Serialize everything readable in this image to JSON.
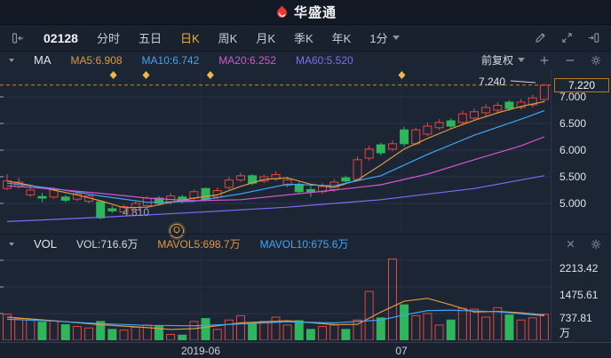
{
  "header": {
    "logo_text": "华盛通"
  },
  "toolbar": {
    "stock_code": "02128",
    "tabs": [
      "分时",
      "五日",
      "日K",
      "周K",
      "月K",
      "季K",
      "年K"
    ],
    "active_tab": "日K",
    "period_dropdown": "1分"
  },
  "chart": {
    "ma_label": "MA",
    "ma_items": [
      {
        "text": "MA5:6.908",
        "color": "#e09a3e"
      },
      {
        "text": "MA10:6.742",
        "color": "#42a4f5"
      },
      {
        "text": "MA20:6.252",
        "color": "#d357cf"
      },
      {
        "text": "MA60:5.520",
        "color": "#7f6cf2"
      }
    ],
    "adjust_label": "前复权",
    "high_label": "7.240",
    "low_label": "4.810",
    "event_marker": "Q",
    "price_axis": {
      "current": "7.220",
      "ticks": [
        "7.000",
        "6.500",
        "6.000",
        "5.500",
        "5.000"
      ]
    }
  },
  "vol": {
    "label": "VOL",
    "value": {
      "text": "VOL:716.6万",
      "color": "#d5dae2"
    },
    "mavol5": {
      "text": "MAVOL5:698.7万",
      "color": "#e09a3e"
    },
    "mavol10": {
      "text": "MAVOL10:675.6万",
      "color": "#42a4f5"
    },
    "axis": [
      "2213.42",
      "1475.61",
      "737.81"
    ],
    "axis_unit": "万"
  },
  "xaxis": {
    "labels": [
      "2019-06",
      "07"
    ]
  },
  "colors": {
    "up": "#e8453c",
    "down": "#2eb65c",
    "ma5": "#e09a3e",
    "ma10": "#42a4f5",
    "ma20": "#d357cf",
    "ma60": "#7f6cf2",
    "accent": "#f0a83c",
    "dashed_line": "#bf8a3e",
    "diamond": "#edb94d",
    "grid": "#28334b",
    "grid_vertical": "#232e44",
    "pointer": "#cfd6df"
  },
  "chart_data": {
    "type": "candlestick+volume",
    "x_axis_labels": [
      "2019-06",
      "07"
    ],
    "price": {
      "ylim": [
        4.45,
        7.35
      ],
      "gridlines": [
        7.0,
        6.5,
        6.0,
        5.5,
        5.0
      ],
      "current_price": 7.22,
      "high_marker": 7.24,
      "low_marker": 4.81,
      "ma_values": {
        "MA5": 6.908,
        "MA10": 6.742,
        "MA20": 6.252,
        "MA60": 5.52
      },
      "candles": [
        [
          5.28,
          5.55,
          5.25,
          5.42
        ],
        [
          5.32,
          5.48,
          5.28,
          5.4
        ],
        [
          5.16,
          5.33,
          5.12,
          5.25
        ],
        [
          5.13,
          5.2,
          5.02,
          5.1
        ],
        [
          5.12,
          5.3,
          5.08,
          5.26
        ],
        [
          5.12,
          5.16,
          5.02,
          5.06
        ],
        [
          5.08,
          5.22,
          5.04,
          5.18
        ],
        [
          5.04,
          5.18,
          5.0,
          5.14
        ],
        [
          5.03,
          5.06,
          4.7,
          4.73
        ],
        [
          4.9,
          4.96,
          4.82,
          4.86
        ],
        [
          4.84,
          4.98,
          4.81,
          4.94
        ],
        [
          4.88,
          5.04,
          4.85,
          5.0
        ],
        [
          4.96,
          5.14,
          4.92,
          5.1
        ],
        [
          5.1,
          5.14,
          4.96,
          5.0
        ],
        [
          5.02,
          5.2,
          4.98,
          5.14
        ],
        [
          5.12,
          5.16,
          5.0,
          5.05
        ],
        [
          5.1,
          5.26,
          5.06,
          5.22
        ],
        [
          5.28,
          5.3,
          5.04,
          5.08
        ],
        [
          5.12,
          5.3,
          5.08,
          5.24
        ],
        [
          5.3,
          5.5,
          5.26,
          5.44
        ],
        [
          5.44,
          5.58,
          5.4,
          5.52
        ],
        [
          5.52,
          5.55,
          5.34,
          5.38
        ],
        [
          5.42,
          5.54,
          5.38,
          5.5
        ],
        [
          5.46,
          5.6,
          5.42,
          5.54
        ],
        [
          5.34,
          5.5,
          5.3,
          5.44
        ],
        [
          5.36,
          5.4,
          5.18,
          5.22
        ],
        [
          5.26,
          5.34,
          5.12,
          5.22
        ],
        [
          5.22,
          5.38,
          5.18,
          5.32
        ],
        [
          5.26,
          5.46,
          5.22,
          5.4
        ],
        [
          5.48,
          5.52,
          5.38,
          5.42
        ],
        [
          5.45,
          5.88,
          5.42,
          5.82
        ],
        [
          5.85,
          6.08,
          5.8,
          6.02
        ],
        [
          6.1,
          6.14,
          5.9,
          5.95
        ],
        [
          6.02,
          6.18,
          5.98,
          6.12
        ],
        [
          6.38,
          6.44,
          6.06,
          6.12
        ],
        [
          6.12,
          6.42,
          6.08,
          6.38
        ],
        [
          6.3,
          6.52,
          6.26,
          6.45
        ],
        [
          6.42,
          6.58,
          6.38,
          6.52
        ],
        [
          6.55,
          6.6,
          6.4,
          6.45
        ],
        [
          6.52,
          6.74,
          6.48,
          6.68
        ],
        [
          6.6,
          6.78,
          6.56,
          6.72
        ],
        [
          6.7,
          6.86,
          6.62,
          6.8
        ],
        [
          6.75,
          6.9,
          6.7,
          6.84
        ],
        [
          6.9,
          6.94,
          6.74,
          6.78
        ],
        [
          6.8,
          6.96,
          6.76,
          6.9
        ],
        [
          6.85,
          7.04,
          6.8,
          6.98
        ],
        [
          6.95,
          7.24,
          6.9,
          7.22
        ]
      ],
      "ma5_points": [
        [
          0,
          5.42
        ],
        [
          2,
          5.34
        ],
        [
          4,
          5.25
        ],
        [
          6,
          5.16
        ],
        [
          8,
          5.05
        ],
        [
          10,
          4.92
        ],
        [
          12,
          4.93
        ],
        [
          14,
          5.02
        ],
        [
          16,
          5.1
        ],
        [
          18,
          5.16
        ],
        [
          20,
          5.32
        ],
        [
          22,
          5.45
        ],
        [
          24,
          5.48
        ],
        [
          26,
          5.36
        ],
        [
          28,
          5.3
        ],
        [
          30,
          5.44
        ],
        [
          32,
          5.72
        ],
        [
          34,
          6.02
        ],
        [
          36,
          6.22
        ],
        [
          38,
          6.4
        ],
        [
          40,
          6.56
        ],
        [
          42,
          6.7
        ],
        [
          44,
          6.82
        ],
        [
          46,
          6.91
        ]
      ],
      "ma10_points": [
        [
          0,
          5.38
        ],
        [
          4,
          5.28
        ],
        [
          8,
          5.14
        ],
        [
          12,
          5.02
        ],
        [
          16,
          5.04
        ],
        [
          20,
          5.18
        ],
        [
          24,
          5.36
        ],
        [
          28,
          5.33
        ],
        [
          32,
          5.52
        ],
        [
          36,
          5.92
        ],
        [
          40,
          6.28
        ],
        [
          44,
          6.58
        ],
        [
          46,
          6.74
        ]
      ],
      "ma20_points": [
        [
          0,
          5.33
        ],
        [
          4,
          5.27
        ],
        [
          8,
          5.19
        ],
        [
          12,
          5.1
        ],
        [
          16,
          5.05
        ],
        [
          20,
          5.07
        ],
        [
          24,
          5.16
        ],
        [
          28,
          5.25
        ],
        [
          32,
          5.35
        ],
        [
          36,
          5.55
        ],
        [
          40,
          5.82
        ],
        [
          44,
          6.08
        ],
        [
          46,
          6.25
        ]
      ],
      "ma60_points": [
        [
          0,
          4.66
        ],
        [
          8,
          4.74
        ],
        [
          16,
          4.83
        ],
        [
          24,
          4.93
        ],
        [
          32,
          5.07
        ],
        [
          40,
          5.28
        ],
        [
          46,
          5.52
        ]
      ],
      "event_diamond_indices": [
        9.1,
        11.9,
        17.4,
        33.8
      ],
      "event_q_index": 14.5
    },
    "volume": {
      "unit": "万",
      "gridlines": [
        737.81,
        1475.61,
        2213.42
      ],
      "vol_values": {
        "VOL": 716.6,
        "MAVOL5": 698.7,
        "MAVOL10": 675.6
      },
      "values": [
        720,
        600,
        560,
        500,
        540,
        430,
        380,
        340,
        520,
        300,
        280,
        360,
        420,
        380,
        160,
        140,
        520,
        600,
        300,
        560,
        680,
        460,
        520,
        640,
        420,
        540,
        300,
        380,
        420,
        300,
        560,
        1350,
        620,
        2250,
        980,
        680,
        740,
        420,
        560,
        880,
        860,
        640,
        900,
        700,
        560,
        620,
        717
      ],
      "mavol5_points": [
        [
          0,
          640
        ],
        [
          4,
          540
        ],
        [
          8,
          430
        ],
        [
          12,
          350
        ],
        [
          14,
          300
        ],
        [
          16,
          320
        ],
        [
          20,
          480
        ],
        [
          24,
          540
        ],
        [
          28,
          430
        ],
        [
          30,
          440
        ],
        [
          32,
          780
        ],
        [
          34,
          1080
        ],
        [
          36,
          1160
        ],
        [
          38,
          980
        ],
        [
          40,
          780
        ],
        [
          42,
          800
        ],
        [
          44,
          760
        ],
        [
          46,
          699
        ]
      ],
      "mavol10_points": [
        [
          0,
          580
        ],
        [
          4,
          530
        ],
        [
          8,
          460
        ],
        [
          12,
          410
        ],
        [
          16,
          400
        ],
        [
          20,
          450
        ],
        [
          24,
          510
        ],
        [
          28,
          480
        ],
        [
          32,
          560
        ],
        [
          34,
          700
        ],
        [
          36,
          820
        ],
        [
          38,
          830
        ],
        [
          40,
          810
        ],
        [
          42,
          790
        ],
        [
          44,
          730
        ],
        [
          46,
          676
        ]
      ]
    }
  }
}
